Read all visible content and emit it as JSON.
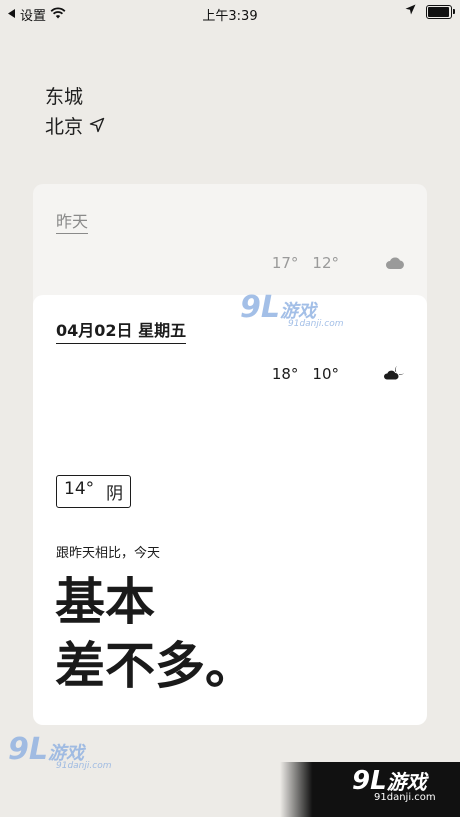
{
  "status_bar": {
    "back_app": "设置",
    "time": "上午3:39",
    "battery_level": 0.95
  },
  "location": {
    "district": "东城",
    "city": "北京"
  },
  "yesterday": {
    "label": "昨天",
    "high": "17°",
    "low": "12°",
    "icon": "cloud-icon"
  },
  "today": {
    "date": "04月02日 星期五",
    "high": "18°",
    "low": "10°",
    "icon": "partly-cloudy-night-icon",
    "current_temp": "14°",
    "current_condition": "阴",
    "compare_text": "跟昨天相比，今天",
    "summary_line1": "基本",
    "summary_line2": "差不多。"
  },
  "watermarks": {
    "logo": "9L",
    "text": "游戏",
    "domain": "91danji.com"
  }
}
